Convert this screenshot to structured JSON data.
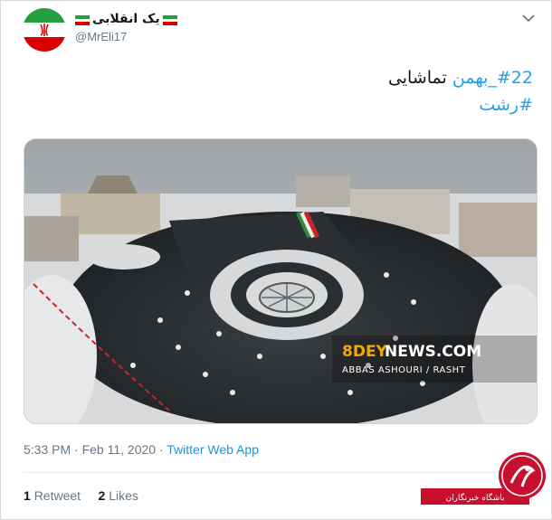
{
  "user": {
    "display_name": "یک انقلابی",
    "handle": "@MrEli17"
  },
  "tweet": {
    "line1_hashtag": "#22_بهمن",
    "line1_text": "تماشایی",
    "line2_hashtag": "#رشت"
  },
  "photo": {
    "watermark_site": "8DEYNEWS.COM",
    "watermark_credit": "ABBAS ASHOURI / RASHT"
  },
  "meta": {
    "time": "5:33 PM",
    "separator": "·",
    "date": "Feb 11, 2020",
    "source": "Twitter Web App"
  },
  "stats": {
    "retweets_count": "1",
    "retweets_label": "Retweet",
    "likes_count": "2",
    "likes_label": "Likes"
  },
  "corner_logo": {
    "text": "باشگاه خبرنگاران"
  },
  "colors": {
    "accent": "#1da1f2",
    "muted": "#657786",
    "logo_red": "#c8102e"
  },
  "icons": {
    "chevron": "chevron-down-icon",
    "avatar": "iran-flag-avatar"
  }
}
